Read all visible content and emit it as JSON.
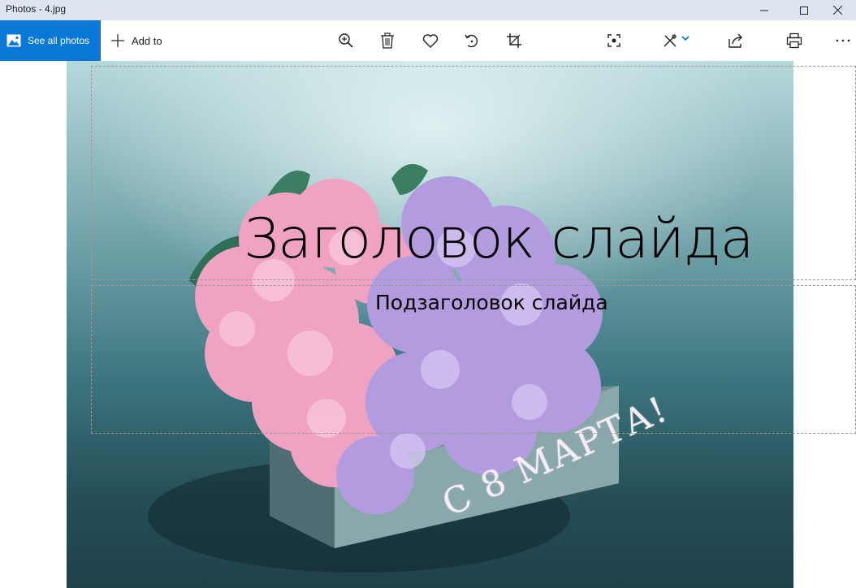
{
  "window": {
    "title": "Photos - 4.jpg",
    "controls": {
      "minimize_icon": "minimize-icon",
      "maximize_icon": "maximize-icon",
      "close_icon": "close-icon"
    }
  },
  "toolbar": {
    "see_all_label": "See all photos",
    "add_to_label": "Add to",
    "tools": [
      "zoom-in-icon",
      "delete-icon",
      "favorite-icon",
      "rotate-icon",
      "crop-icon",
      "enhance-icon",
      "edit-draw-icon",
      "share-icon",
      "print-icon",
      "more-icon"
    ],
    "accent": "#0a78d7"
  },
  "image": {
    "slide_title": "Заголовок слайда",
    "slide_subtitle": "Подзаголовок слайда",
    "card_text": "С 8 МАРТА!"
  }
}
